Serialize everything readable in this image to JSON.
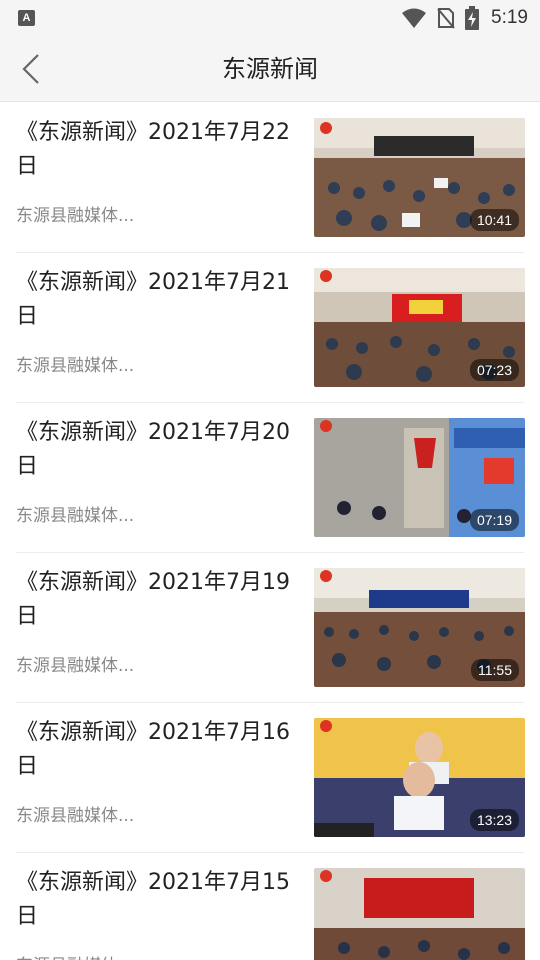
{
  "status_bar": {
    "time": "5:19",
    "notification_icon": "A"
  },
  "header": {
    "title": "东源新闻"
  },
  "news": [
    {
      "title": "《东源新闻》2021年7月22日",
      "source": "东源县融媒体...",
      "duration": "10:41"
    },
    {
      "title": "《东源新闻》2021年7月21日",
      "source": "东源县融媒体...",
      "duration": "07:23"
    },
    {
      "title": "《东源新闻》2021年7月20日",
      "source": "东源县融媒体...",
      "duration": "07:19"
    },
    {
      "title": "《东源新闻》2021年7月19日",
      "source": "东源县融媒体...",
      "duration": "11:55"
    },
    {
      "title": "《东源新闻》2021年7月16日",
      "source": "东源县融媒体...",
      "duration": "13:23"
    },
    {
      "title": "《东源新闻》2021年7月15日",
      "source": "东源县融媒体...",
      "duration": ""
    }
  ]
}
